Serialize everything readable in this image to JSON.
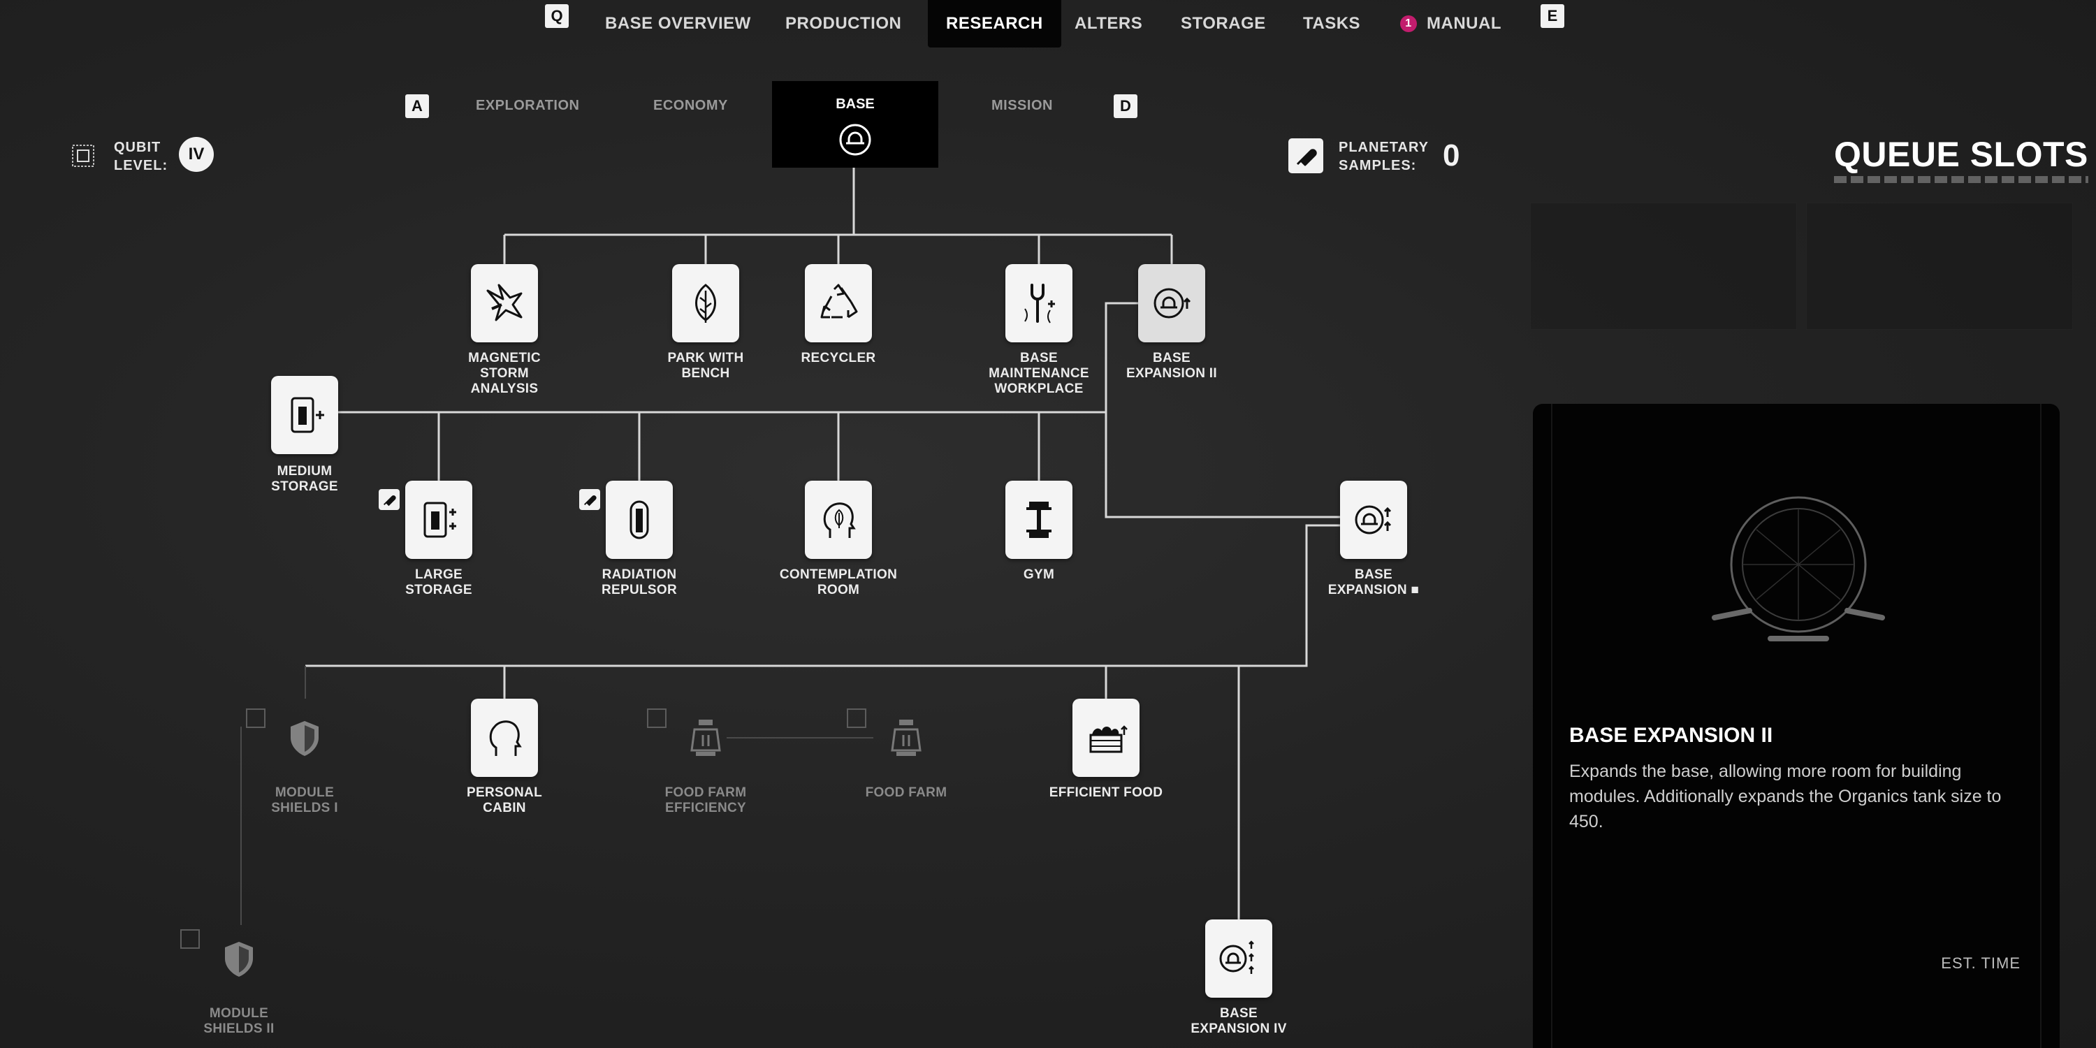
{
  "nav": {
    "key_left": "Q",
    "key_right": "E",
    "tabs": [
      "BASE OVERVIEW",
      "PRODUCTION",
      "RESEARCH",
      "ALTERS",
      "STORAGE",
      "TASKS",
      "MANUAL"
    ],
    "manual_badge": "1",
    "active": "RESEARCH"
  },
  "subnav": {
    "key_left": "A",
    "key_right": "D",
    "tabs": [
      "EXPLORATION",
      "ECONOMY",
      "BASE",
      "MISSION"
    ],
    "active": "BASE"
  },
  "stats": {
    "qubit_label_1": "QUBIT",
    "qubit_label_2": "LEVEL:",
    "qubit_value": "IV",
    "samples_label_1": "PLANETARY",
    "samples_label_2": "SAMPLES:",
    "samples_value": "0",
    "queue_title": "QUEUE SLOTS"
  },
  "nodes": {
    "magnetic": {
      "label": "MAGNETIC\nSTORM\nANALYSIS",
      "icon": "magnetic-storm-icon"
    },
    "park": {
      "label": "PARK WITH\nBENCH",
      "icon": "leaf-icon"
    },
    "recycler": {
      "label": "RECYCLER",
      "icon": "recycle-icon"
    },
    "maintenance": {
      "label": "BASE\nMAINTENANCE\nWORKPLACE",
      "icon": "wrench-icon"
    },
    "expansion2": {
      "label": "BASE\nEXPANSION II",
      "icon": "base-expansion-icon"
    },
    "medium": {
      "label": "MEDIUM\nSTORAGE",
      "icon": "storage-icon"
    },
    "large": {
      "label": "LARGE\nSTORAGE",
      "icon": "storage-plus-icon"
    },
    "radiation": {
      "label": "RADIATION\nREPULSOR",
      "icon": "repulsor-icon"
    },
    "contemplation": {
      "label": "CONTEMPLATION\nROOM",
      "icon": "head-leaf-icon"
    },
    "gym": {
      "label": "GYM",
      "icon": "dumbbell-icon"
    },
    "expansion3": {
      "label": "BASE\nEXPANSION ■",
      "icon": "base-expansion-icon"
    },
    "shields1": {
      "label": "MODULE\nSHIELDS I",
      "icon": "shield-icon"
    },
    "cabin": {
      "label": "PERSONAL\nCABIN",
      "icon": "person-head-icon"
    },
    "foodfarmeff": {
      "label": "FOOD FARM\nEFFICIENCY",
      "icon": "food-farm-icon"
    },
    "foodfarm": {
      "label": "FOOD FARM",
      "icon": "food-farm-icon"
    },
    "efficient": {
      "label": "EFFICIENT FOOD",
      "icon": "food-crate-icon"
    },
    "shields2": {
      "label": "MODULE\nSHIELDS II",
      "icon": "shield-icon"
    },
    "expansion4": {
      "label": "BASE\nEXPANSION IV",
      "icon": "base-expansion-icon"
    }
  },
  "panel": {
    "title": "BASE EXPANSION II",
    "description": "Expands the base, allowing more room for building modules. Additionally expands the Organics tank size to 450.",
    "est_time": "EST. TIME"
  },
  "colors": {
    "accent_badge": "#c21d6d",
    "node_bg": "#f4f4f4",
    "panel_bg": "#030303"
  }
}
